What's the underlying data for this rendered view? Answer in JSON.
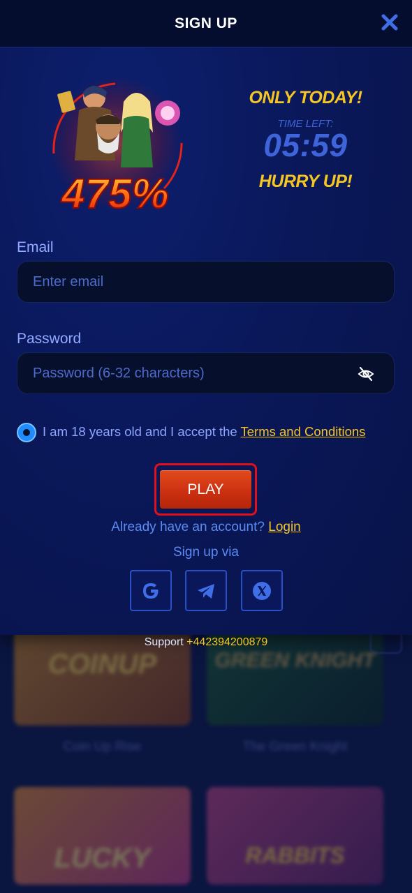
{
  "header": {
    "title": "SIGN UP"
  },
  "promo": {
    "bonus": "475%",
    "only_today": "ONLY TODAY!",
    "time_left_label": "TIME LEFT:",
    "timer": "05:59",
    "hurry": "HURRY UP!"
  },
  "form": {
    "email_label": "Email",
    "email_placeholder": "Enter email",
    "password_label": "Password",
    "password_placeholder": "Password (6-32 characters)",
    "consent_text": "I am 18 years old and I accept the ",
    "terms_link": "Terms and Conditions",
    "play_label": "PLAY",
    "already_text": "Already have an account? ",
    "login_link": "Login",
    "signup_via": "Sign up via"
  },
  "social": [
    "google-icon",
    "telegram-icon",
    "x-icon"
  ],
  "footer": {
    "support_label": "Support ",
    "support_phone": "+442394200879"
  },
  "background_games": [
    {
      "name": "Coin Up Rise",
      "title": "COINUP"
    },
    {
      "name": "The Green Knight",
      "title": "GREEN KNIGHT"
    },
    {
      "name": "",
      "title": "LUCKY"
    },
    {
      "name": "",
      "title": "RABBITS"
    }
  ],
  "colors": {
    "accent_yellow": "#f5c523",
    "timer_blue": "#3f63d8",
    "play_red": "#c92f10"
  }
}
